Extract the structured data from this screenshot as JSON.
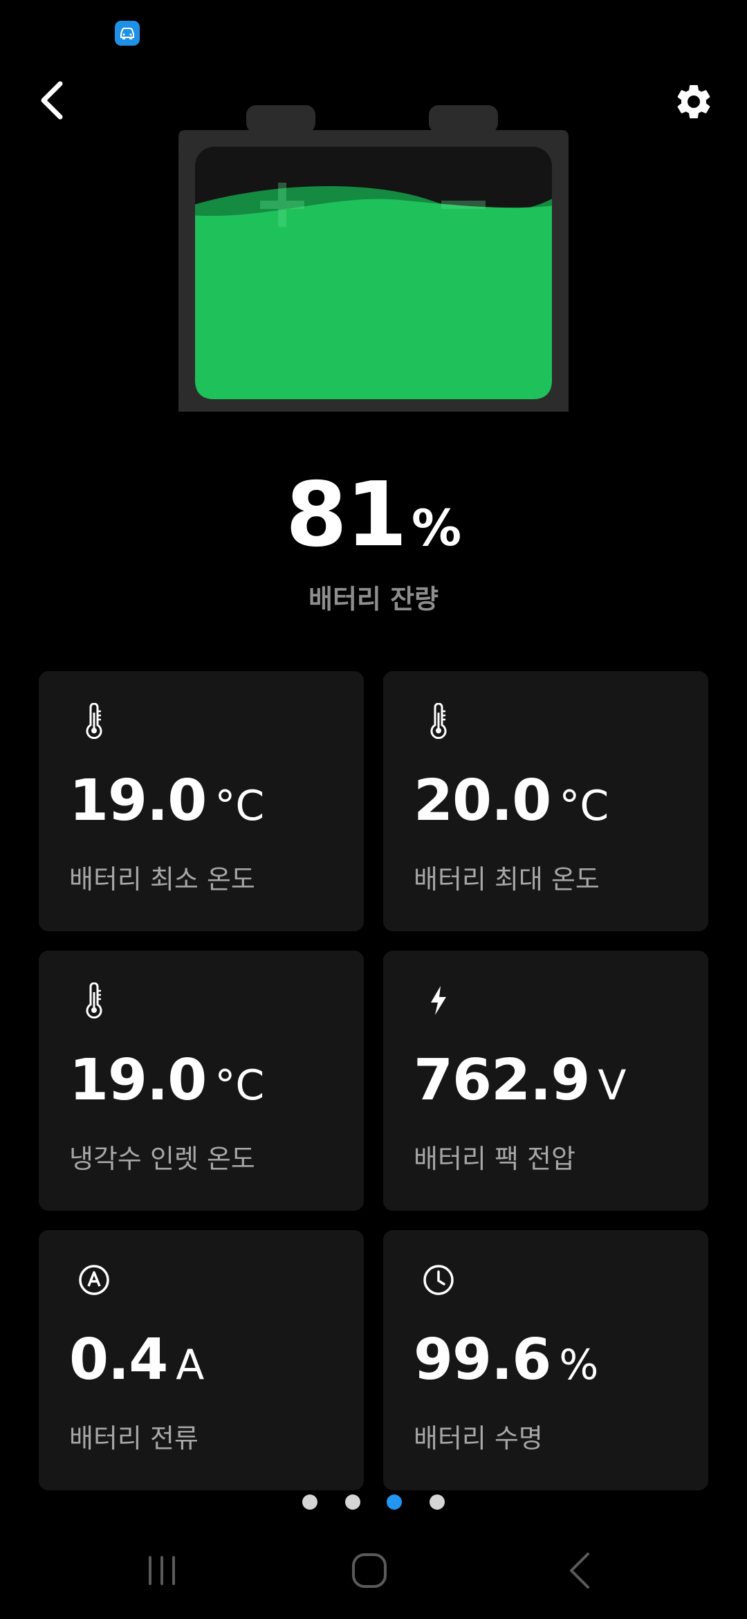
{
  "battery": {
    "percent_value": "81",
    "percent_unit": "%",
    "label": "배터리 잔량",
    "level": 0.81,
    "fill_color": "#1ec15a"
  },
  "cards": [
    {
      "icon": "thermometer-icon",
      "value": "19.0",
      "unit": "°C",
      "label": "배터리 최소 온도"
    },
    {
      "icon": "thermometer-icon",
      "value": "20.0",
      "unit": "°C",
      "label": "배터리 최대 온도"
    },
    {
      "icon": "thermometer-icon",
      "value": "19.0",
      "unit": "°C",
      "label": "냉각수 인렛 온도"
    },
    {
      "icon": "lightning-bolt-icon",
      "value": "762.9",
      "unit": "V",
      "label": "배터리 팩 전압"
    },
    {
      "icon": "ampere-icon",
      "value": "0.4",
      "unit": "A",
      "label": "배터리 전류"
    },
    {
      "icon": "clock-icon",
      "value": "99.6",
      "unit": "%",
      "label": "배터리 수명"
    }
  ],
  "pager": {
    "count": 4,
    "active_index": 2,
    "active_color": "#2196f3"
  },
  "nav_icons": [
    "recent-apps-icon",
    "home-icon",
    "back-icon"
  ]
}
